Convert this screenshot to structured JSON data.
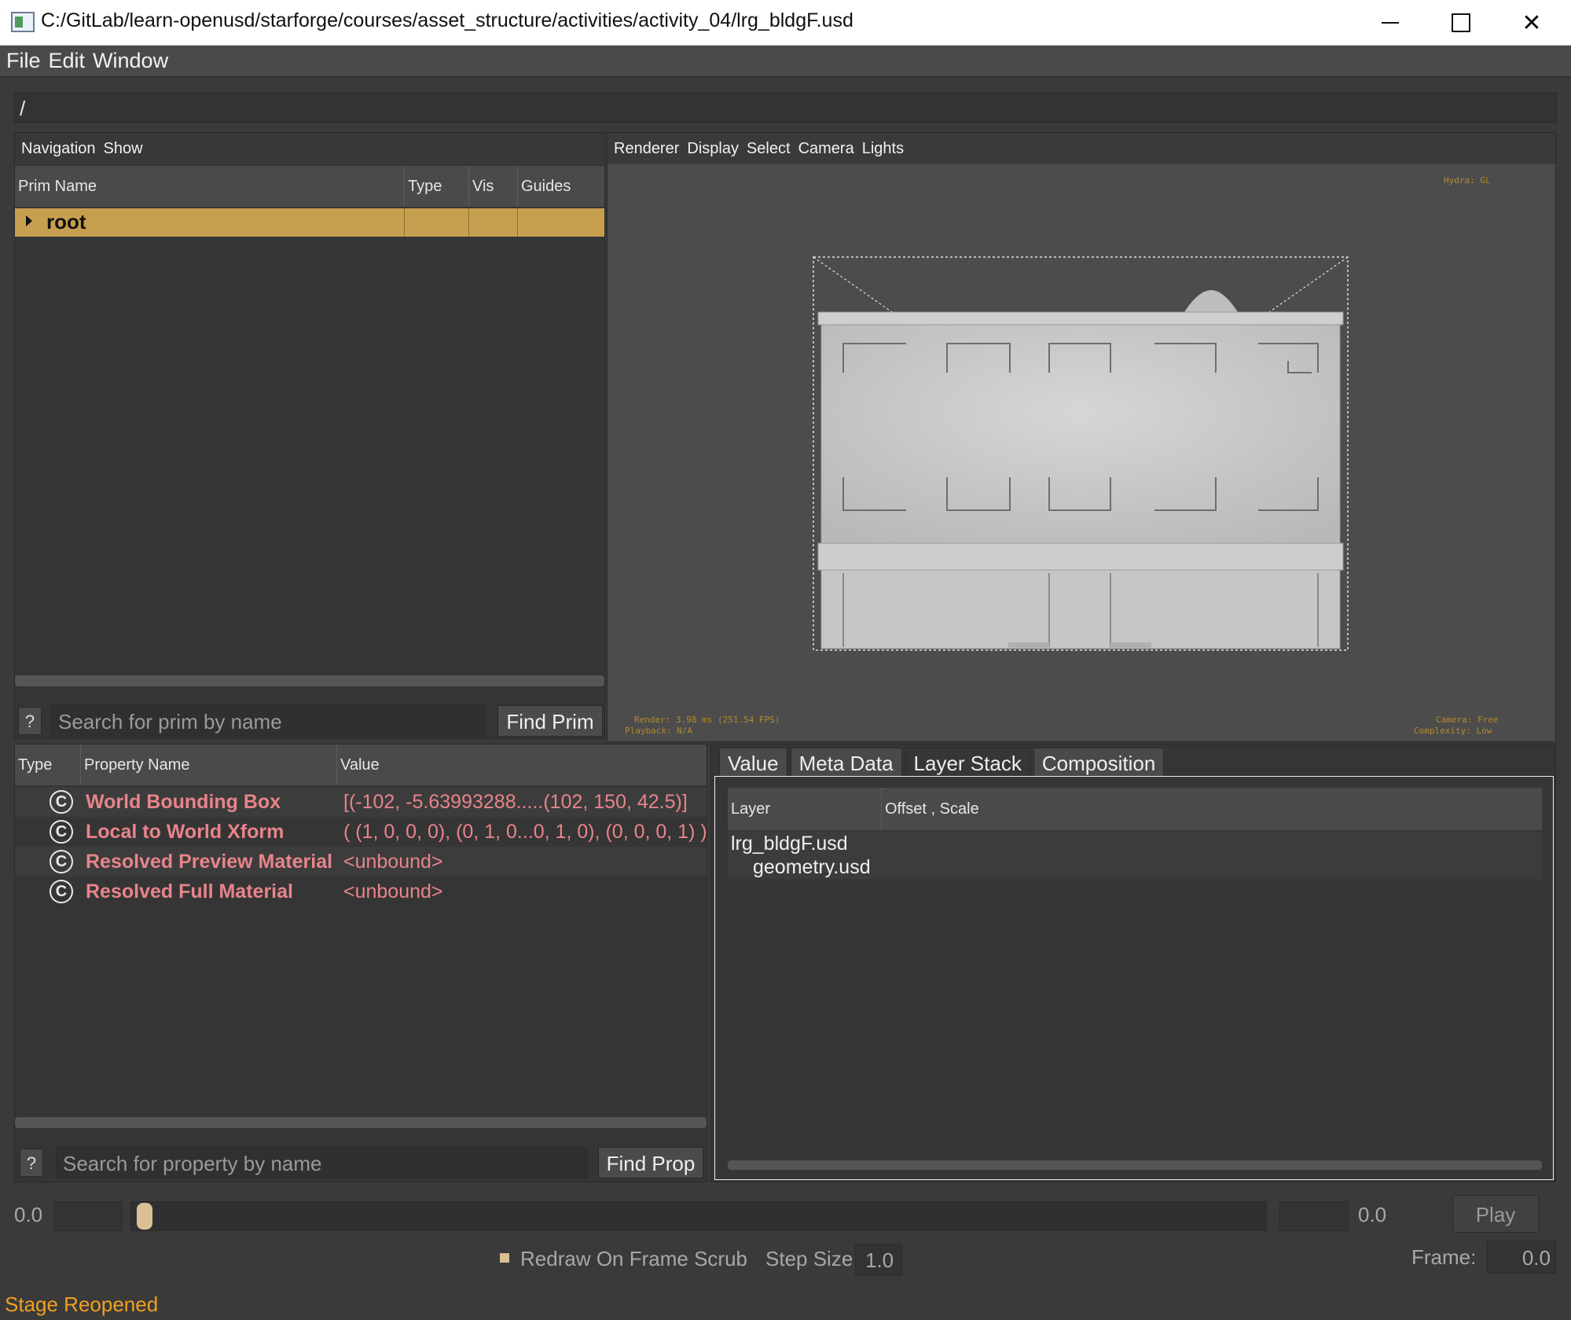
{
  "window": {
    "title": "C:/GitLab/learn-openusd/starforge/courses/asset_structure/activities/activity_04/lrg_bldgF.usd",
    "close_glyph": "✕"
  },
  "menubar": [
    "File",
    "Edit",
    "Window"
  ],
  "path": "/",
  "navigation": {
    "menus": [
      "Navigation",
      "Show"
    ],
    "columns": [
      "Prim Name",
      "Type",
      "Vis",
      "Guides"
    ],
    "rows": [
      {
        "name": "root",
        "type": "",
        "vis": "",
        "guides": ""
      }
    ],
    "help_label": "?",
    "search_placeholder": "Search for prim by name",
    "find_label": "Find Prim"
  },
  "viewport": {
    "menus": [
      "Renderer",
      "Display",
      "Select",
      "Camera",
      "Lights"
    ],
    "hud": {
      "top_right": "Hydra: GL",
      "bottom_left_1": "Render: 3.98 ms (251.54 FPS)",
      "bottom_left_2": "Playback: N/A",
      "bottom_right_1": "Camera: Free",
      "bottom_right_2": "Complexity: Low"
    }
  },
  "properties": {
    "columns": [
      "Type",
      "Property Name",
      "Value"
    ],
    "type_icon": "C",
    "rows": [
      {
        "name": "World Bounding Box",
        "value": "[(-102, -5.63993288.....(102, 150, 42.5)]"
      },
      {
        "name": "Local to World Xform",
        "value": "( (1, 0, 0, 0), (0, 1, 0...0, 1, 0), (0, 0, 0, 1) )"
      },
      {
        "name": "Resolved Preview Material",
        "value": "<unbound>"
      },
      {
        "name": "Resolved Full Material",
        "value": "<unbound>"
      }
    ],
    "help_label": "?",
    "search_placeholder": "Search for property by name",
    "find_label": "Find Prop"
  },
  "layer_panel": {
    "tabs": [
      "Value",
      "Meta Data",
      "Layer Stack",
      "Composition"
    ],
    "active_tab": "Layer Stack",
    "columns": [
      "Layer",
      "Offset , Scale"
    ],
    "rows": [
      "lrg_bldgF.usd",
      "geometry.usd"
    ]
  },
  "timeline": {
    "start_label": "0.0",
    "end_label": "0.0",
    "current_fraction": 0.0,
    "play_label": "Play",
    "redraw_label": "Redraw On Frame Scrub",
    "step_label": "Step Size",
    "step_value": "1.0",
    "frame_label": "Frame:",
    "frame_value": "0.0"
  },
  "status": "Stage Reopened",
  "colors": {
    "selection": "#c7a04f",
    "property_text": "#e8848a",
    "status_text": "#f0a020",
    "hud_text": "#b38a2e"
  }
}
